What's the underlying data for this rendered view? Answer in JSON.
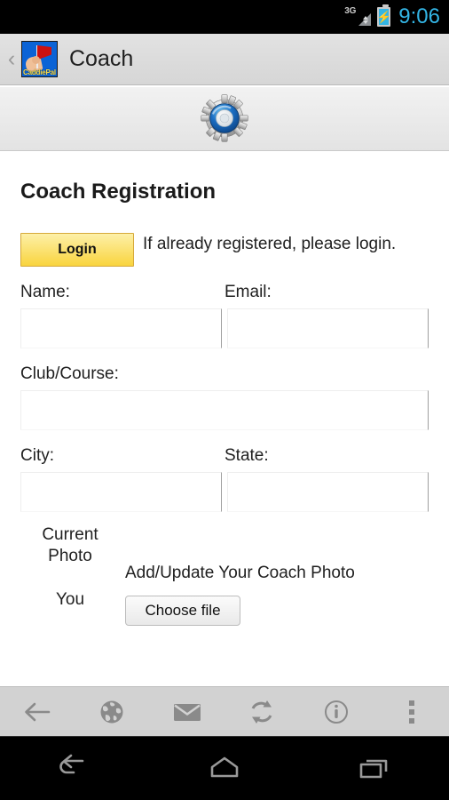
{
  "status_bar": {
    "network": "3G",
    "time": "9:06",
    "battery_icon": "battery-charging-icon",
    "signal_icon": "signal-3g-icon"
  },
  "action_bar": {
    "back_icon": "back-chevron-icon",
    "app_icon": "caddiepal-app-icon",
    "app_brand": "CaddiePal",
    "title": "Coach"
  },
  "banner": {
    "icon": "gear-icon"
  },
  "page": {
    "title": "Coach Registration",
    "login_button": "Login",
    "login_note": "If already registered, please login."
  },
  "form": {
    "fields": [
      {
        "label": "Name:",
        "value": "",
        "placeholder": "",
        "name": "name"
      },
      {
        "label": "Email:",
        "value": "",
        "placeholder": "",
        "name": "email"
      },
      {
        "label": "Club/Course:",
        "value": "",
        "placeholder": "",
        "name": "club-course"
      },
      {
        "label": "City:",
        "value": "",
        "placeholder": "",
        "name": "city"
      },
      {
        "label": "State:",
        "value": "",
        "placeholder": "",
        "name": "state"
      }
    ]
  },
  "photo": {
    "current_label_line1": "Current",
    "current_label_line2": "Photo",
    "you_label": "You",
    "caption": "Add/Update Your Coach Photo",
    "choose_button": "Choose file"
  },
  "toolbar": {
    "items": [
      {
        "icon": "back-arrow-icon",
        "name": "toolbar-back"
      },
      {
        "icon": "globe-icon",
        "name": "toolbar-bookmarks"
      },
      {
        "icon": "mail-icon",
        "name": "toolbar-mail"
      },
      {
        "icon": "refresh-icon",
        "name": "toolbar-refresh"
      },
      {
        "icon": "info-icon",
        "name": "toolbar-info"
      },
      {
        "icon": "overflow-menu-icon",
        "name": "toolbar-menu"
      }
    ]
  },
  "navbar": {
    "items": [
      {
        "icon": "nav-back-icon",
        "name": "nav-back"
      },
      {
        "icon": "nav-home-icon",
        "name": "nav-home"
      },
      {
        "icon": "nav-recents-icon",
        "name": "nav-recents"
      }
    ]
  },
  "colors": {
    "accent": "#33b5e5",
    "login_button": "#f9d43e",
    "toolbar_bg": "#d2d2d2",
    "app_icon_bg": "#0b63d6"
  }
}
